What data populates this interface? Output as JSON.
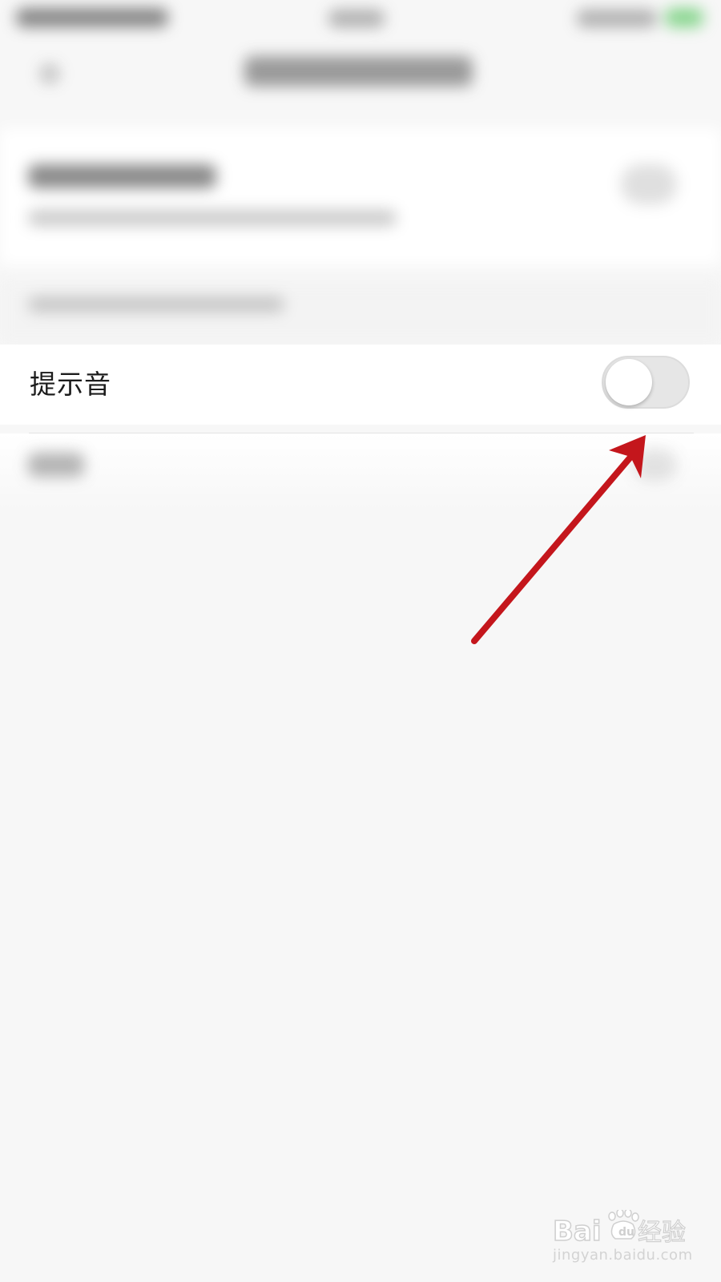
{
  "settings": {
    "sound_row": {
      "label": "提示音",
      "toggle_on": false
    }
  },
  "colors": {
    "background": "#f7f7f7",
    "row_background": "#ffffff",
    "toggle_off_track": "#e6e6e6",
    "annotation_arrow": "#c4161c",
    "status_battery": "#3fbf4a"
  },
  "watermark": {
    "logo_text": "Baidu经验",
    "url": "jingyan.baidu.com"
  }
}
